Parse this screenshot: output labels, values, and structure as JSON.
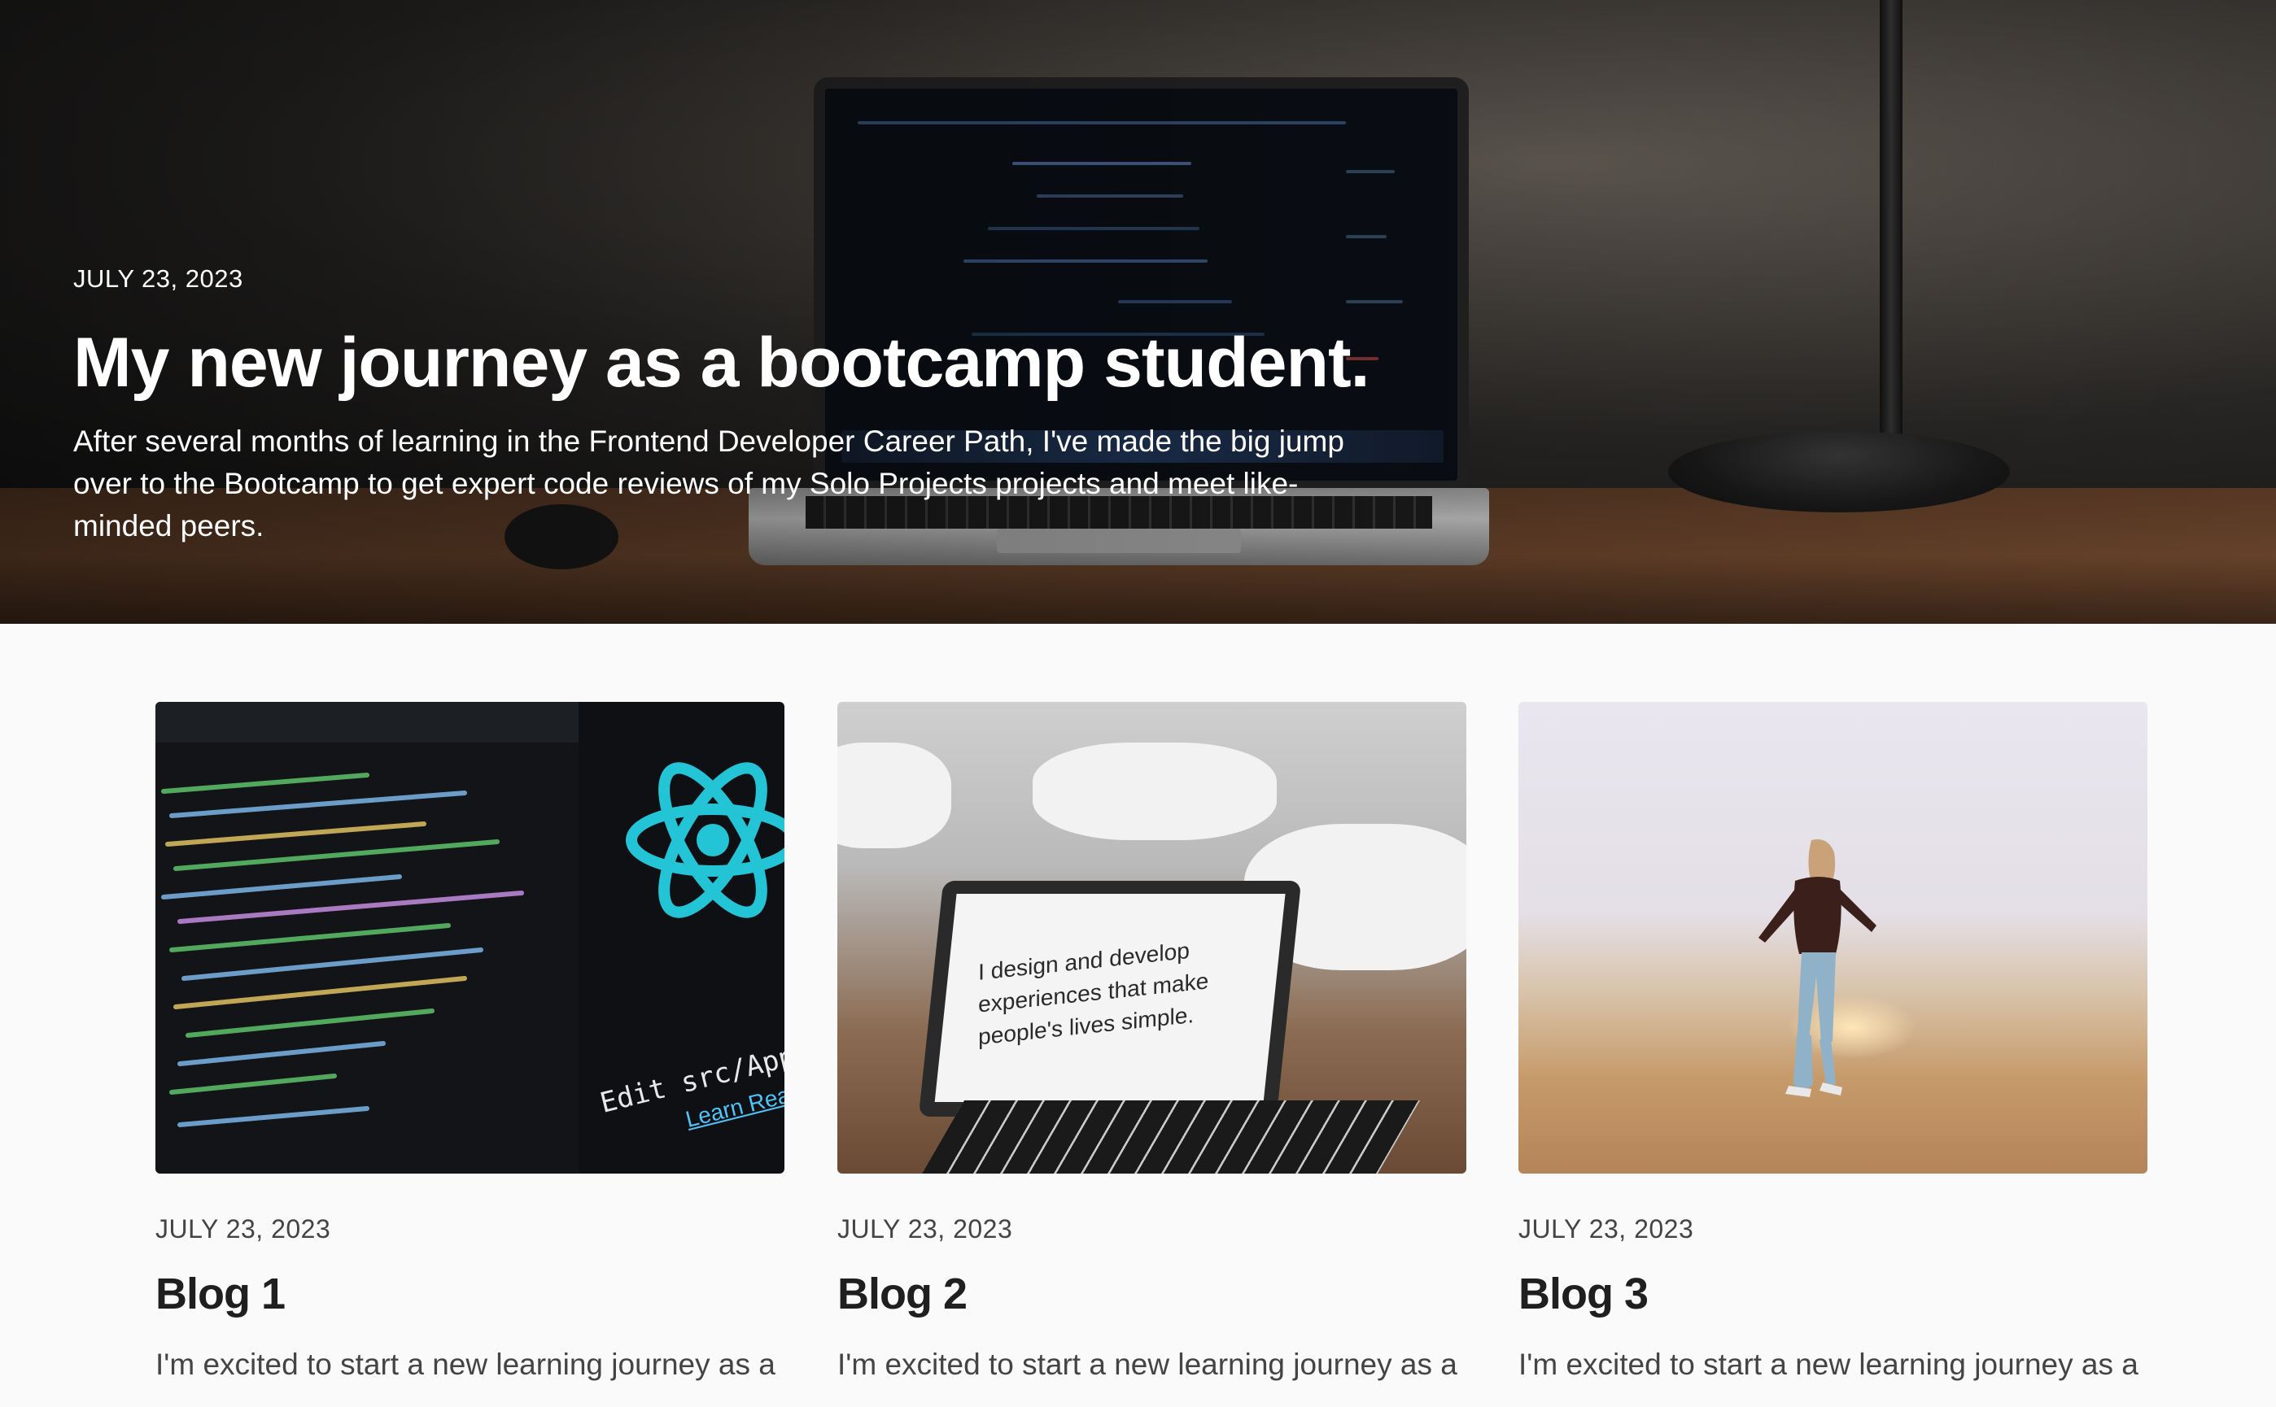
{
  "hero": {
    "date": "JULY 23, 2023",
    "title": "My new journey as a bootcamp student.",
    "description": "After several months of learning in the Frontend Developer Career Path, I've made the big jump over to the Bootcamp to get expert code reviews of my Solo Projects projects and meet like-minded peers."
  },
  "posts": [
    {
      "date": "JULY 23, 2023",
      "title": "Blog 1",
      "excerpt": "I'm excited to start a new learning journey as a",
      "image_text": [
        "Edit src/App.js and save",
        "Learn React"
      ]
    },
    {
      "date": "JULY 23, 2023",
      "title": "Blog 2",
      "excerpt": "I'm excited to start a new learning journey as a",
      "image_text": [
        "I design and develop experiences that make people's lives simple."
      ]
    },
    {
      "date": "JULY 23, 2023",
      "title": "Blog 3",
      "excerpt": "I'm excited to start a new learning journey as a"
    }
  ]
}
